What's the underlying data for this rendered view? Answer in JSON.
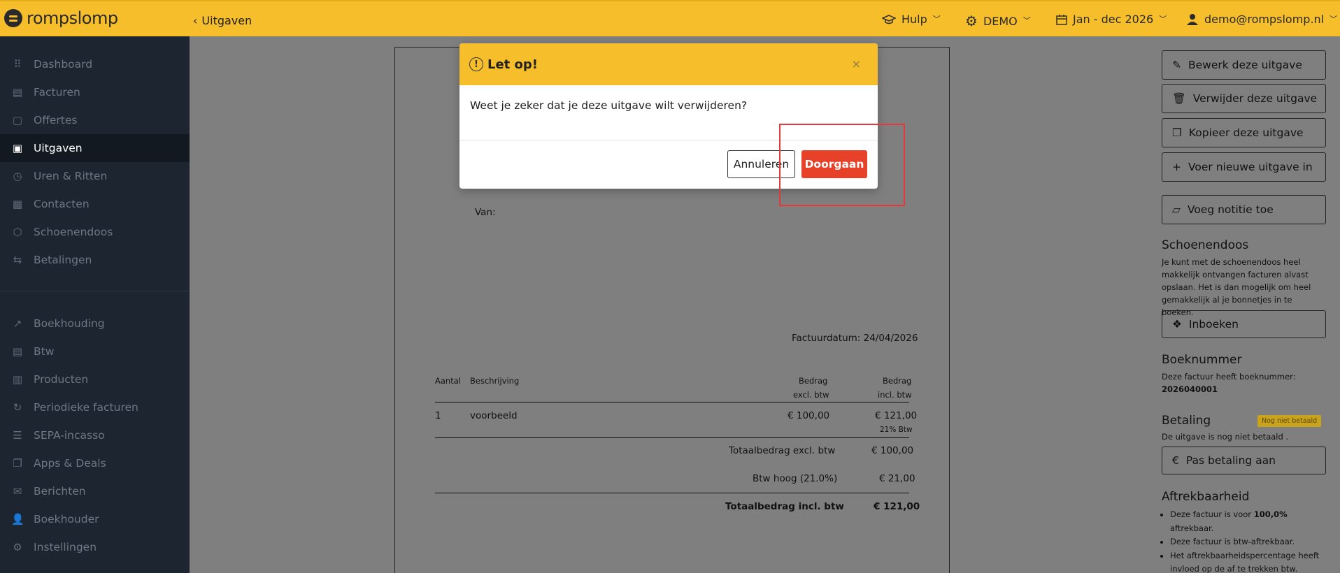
{
  "app": {
    "logo_text": "rompslomp"
  },
  "header": {
    "back_label": "Uitgaven",
    "help_label": "Hulp",
    "company_label": "DEMO",
    "period_label": "Jan - dec 2026",
    "user_label": "demo@rompslomp.nl"
  },
  "sidebar": {
    "items": [
      {
        "label": "Dashboard",
        "icon": "grid-icon"
      },
      {
        "label": "Facturen",
        "icon": "invoice-icon"
      },
      {
        "label": "Offertes",
        "icon": "quote-icon"
      },
      {
        "label": "Uitgaven",
        "icon": "expense-icon",
        "active": true
      },
      {
        "label": "Uren & Ritten",
        "icon": "clock-icon"
      },
      {
        "label": "Contacten",
        "icon": "contact-icon"
      },
      {
        "label": "Schoenendoos",
        "icon": "box-icon"
      },
      {
        "label": "Betalingen",
        "icon": "transfer-icon"
      },
      {
        "label": "Boekhouding",
        "icon": "chart-icon"
      },
      {
        "label": "Btw",
        "icon": "tax-icon"
      },
      {
        "label": "Producten",
        "icon": "product-icon"
      },
      {
        "label": "Periodieke facturen",
        "icon": "refresh-icon"
      },
      {
        "label": "SEPA-incasso",
        "icon": "list-icon"
      },
      {
        "label": "Apps & Deals",
        "icon": "apps-icon"
      },
      {
        "label": "Berichten",
        "icon": "mail-icon"
      },
      {
        "label": "Boekhouder",
        "icon": "user-icon"
      },
      {
        "label": "Instellingen",
        "icon": "gear-icon"
      }
    ]
  },
  "document": {
    "from_label": "Van:",
    "invoice_date": "Factuurdatum: 24/04/2026",
    "col_qty": "Aantal",
    "col_desc": "Beschrijving",
    "col_amount_ex": "Bedrag",
    "col_amount_ex_sub": "excl. btw",
    "col_amount_in": "Bedrag",
    "col_amount_in_sub": "incl. btw",
    "row_qty": "1",
    "row_desc": "voorbeeld",
    "row_ex": "€ 100,00",
    "row_in": "€ 121,00",
    "row_vat": "21% Btw",
    "total_ex_label": "Totaalbedrag excl. btw",
    "total_ex": "€ 100,00",
    "vat_label": "Btw hoog (21.0%)",
    "vat_value": "€ 21,00",
    "total_in_label": "Totaalbedrag incl. btw",
    "total_in": "€ 121,00"
  },
  "right_panel": {
    "edit_btn": "Bewerk deze uitgave",
    "delete_btn": "Verwijder deze uitgave",
    "copy_btn": "Kopieer deze uitgave",
    "new_btn": "Voer nieuwe uitgave in",
    "note_btn": "Voeg notitie toe",
    "shoebox_title": "Schoenendoos",
    "shoebox_text": "Je kunt met de schoenendoos heel makkelijk ontvangen facturen alvast opslaan. Het is dan mogelijk om heel gemakkelijk al je bonnetjes in te boeken.",
    "inboeken_btn": "Inboeken",
    "booknr_title": "Boeknummer",
    "booknr_text": "Deze factuur heeft boeknummer:",
    "booknr_value": "2026040001",
    "payment_title": "Betaling",
    "payment_badge": "Nog niet betaald",
    "payment_text": "De uitgave is nog niet betaald .",
    "payment_btn": "Pas betaling aan",
    "deduct_title": "Aftrekbaarheid",
    "deduct_item1_pre": "Deze factuur is voor ",
    "deduct_item1_bold": "100,0%",
    "deduct_item1_post": " aftrekbaar.",
    "deduct_item2": "Deze factuur is btw-aftrekbaar.",
    "deduct_item3": "Het aftrekbaarheidspercentage heeft invloed op de af te trekken btw."
  },
  "modal": {
    "title": "Let op!",
    "close": "×",
    "message": "Weet je zeker dat je deze uitgave wilt verwijderen?",
    "cancel_label": "Annuleren",
    "confirm_label": "Doorgaan"
  },
  "colors": {
    "brand": "#f6be2b",
    "sidebar": "#1c2530",
    "danger": "#e8412a"
  }
}
